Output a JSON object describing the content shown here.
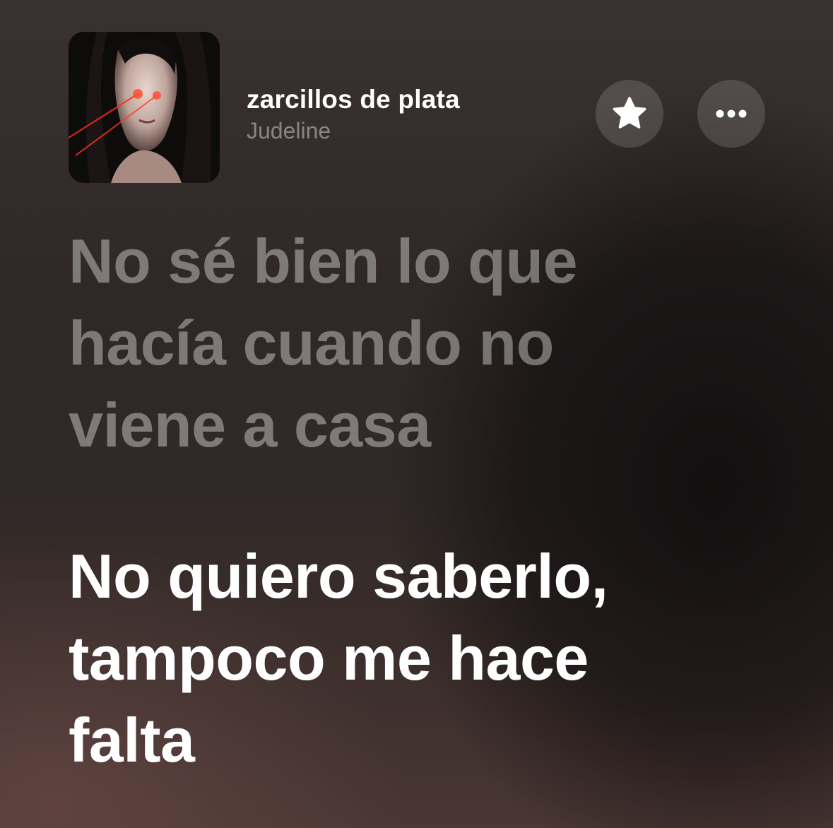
{
  "now_playing": {
    "title": "zarcillos de plata",
    "artist": "Judeline",
    "album_art_icon": "album-cover-portrait"
  },
  "actions": {
    "favorite_icon": "star-icon",
    "more_icon": "ellipsis-icon"
  },
  "lyrics": {
    "past": [
      "No sé bien lo que",
      "hacía cuando no",
      "viene a casa"
    ],
    "current": [
      "No quiero saberlo,",
      "tampoco me hace",
      "falta"
    ]
  }
}
